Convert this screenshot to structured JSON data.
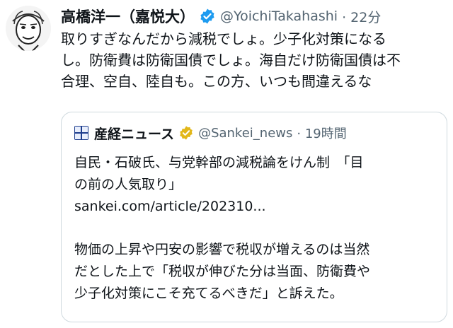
{
  "tweet": {
    "display_name": "高橋洋一（嘉悦大）",
    "handle": "@YoichiTakahashi",
    "time": "· 22分",
    "avatar_icon": "caricature-avatar-icon",
    "verified_icon": "blue-verified-badge-icon",
    "text_lines": [
      "取りすぎなんだから減税でしょ。少子化対策になる",
      "し。防衛費は防衛国債でしょ。海自だけ防衛国債は不",
      "合理、空自、陸自も。この方、いつも間違えるな"
    ]
  },
  "quoted": {
    "logo_icon": "sankei-logo-icon",
    "display_name": "産経ニュース",
    "verified_icon": "gold-verified-badge-icon",
    "handle": "@Sankei_news",
    "time": "· 19時間",
    "headline_lines": [
      "自民・石破氏、与党幹部の減税論をけん制　「目",
      "の前の人気取り」"
    ],
    "link": "sankei.com/article/202310...",
    "body_lines": [
      "物価の上昇や円安の影響で税収が増えるのは当然",
      "だとした上で「税収が伸びた分は当面、防衛費や",
      "少子化対策にこそ充てるべきだ」と訴えた。"
    ]
  },
  "colors": {
    "text": "#0f1419",
    "secondary": "#536471",
    "border": "#cfd9de",
    "verified_blue": "#1d9bf0",
    "verified_gold": "#e2b719"
  }
}
